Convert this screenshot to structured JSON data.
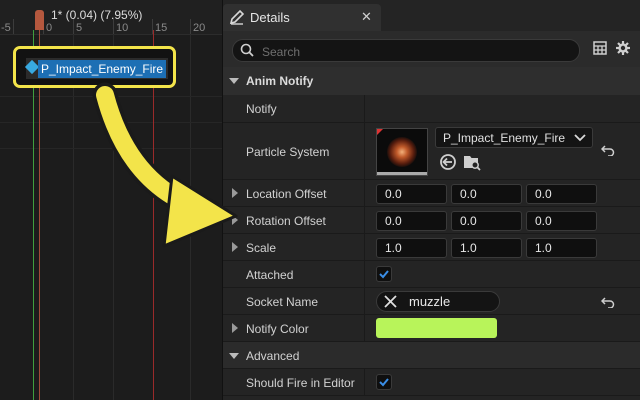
{
  "timeline": {
    "frame_info": "1* (0.04) (7.95%)",
    "ticks": [
      "-5",
      "0",
      "5",
      "10",
      "15",
      "20"
    ],
    "notify_label": "P_Impact_Enemy_Fire",
    "highlight_color": "#f3e44a",
    "arrow_color": "#f3e44a"
  },
  "panel": {
    "tab_label": "Details",
    "search_placeholder": "Search",
    "category_anim_notify": "Anim Notify",
    "category_advanced": "Advanced"
  },
  "rows": {
    "notify": {
      "label": "Notify"
    },
    "particle_system": {
      "label": "Particle System",
      "asset": "P_Impact_Enemy_Fire"
    },
    "location_offset": {
      "label": "Location Offset",
      "x": "0.0",
      "y": "0.0",
      "z": "0.0"
    },
    "rotation_offset": {
      "label": "Rotation Offset",
      "x": "0.0",
      "y": "0.0",
      "z": "0.0"
    },
    "scale": {
      "label": "Scale",
      "x": "1.0",
      "y": "1.0",
      "z": "1.0"
    },
    "attached": {
      "label": "Attached",
      "checked": true
    },
    "socket_name": {
      "label": "Socket Name",
      "value": "muzzle"
    },
    "notify_color": {
      "label": "Notify Color",
      "color": "#b8f45a"
    },
    "should_fire_in_editor": {
      "label": "Should Fire in Editor",
      "checked": true
    }
  },
  "colors": {
    "accent_blue": "#1d6fb4",
    "checkbox_check": "#3a8ee6",
    "playhead": "#b5583e"
  }
}
